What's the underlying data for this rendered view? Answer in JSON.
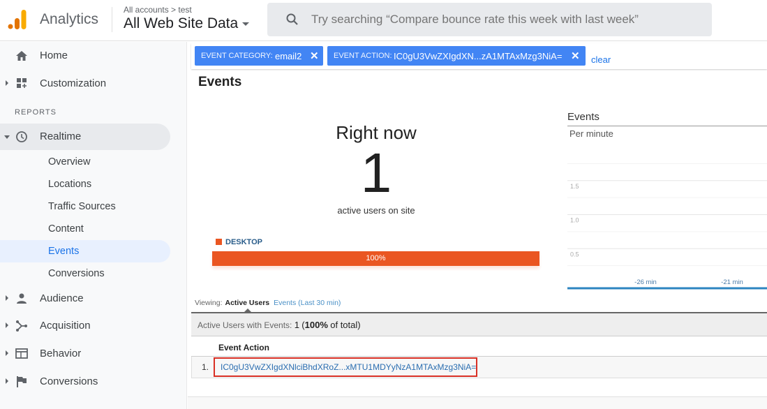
{
  "header": {
    "brand": "Analytics",
    "breadcrumb": "All accounts > test",
    "property": "All Web Site Data",
    "search_placeholder": "Try searching “Compare bounce rate this week with last week”",
    "logo_colors": [
      "#f9ab00",
      "#e37400"
    ]
  },
  "sidebar": {
    "top_items": [
      {
        "label": "Home",
        "icon": "home-icon"
      },
      {
        "label": "Customization",
        "icon": "dashboard-icon"
      }
    ],
    "section_label": "REPORTS",
    "realtime": {
      "label": "Realtime",
      "icon": "clock-icon",
      "children": [
        "Overview",
        "Locations",
        "Traffic Sources",
        "Content",
        "Events",
        "Conversions"
      ],
      "active_child": "Events"
    },
    "report_items": [
      {
        "label": "Audience",
        "icon": "person-icon"
      },
      {
        "label": "Acquisition",
        "icon": "acquisition-icon"
      },
      {
        "label": "Behavior",
        "icon": "behavior-icon"
      },
      {
        "label": "Conversions",
        "icon": "flag-icon"
      }
    ]
  },
  "filters": [
    {
      "key": "EVENT CATEGORY:",
      "value": "email2"
    },
    {
      "key": "EVENT ACTION:",
      "value": "IC0gU3VwZXIgdXN...zA1MTAxMzg3NiA="
    }
  ],
  "filters_clear": "clear",
  "page_title": "Events",
  "right_now": {
    "title": "Right now",
    "count": "1",
    "subtitle": "active users on site",
    "device_label": "DESKTOP",
    "device_percent": 100,
    "device_percent_label": "100%",
    "device_color": "#ea5622"
  },
  "chart_data": {
    "type": "bar",
    "title": "Events",
    "subtitle": "Per minute",
    "y_ticks": [
      "1.5",
      "1.0",
      "0.5"
    ],
    "x_ticks": [
      "-26 min",
      "-21 min"
    ],
    "ylim": [
      0,
      2
    ],
    "series": [
      {
        "name": "Events",
        "values": []
      }
    ],
    "grid": true,
    "axis_color": "#2c84c0"
  },
  "viewing": {
    "label": "Viewing:",
    "active_tab": "Active Users",
    "other_tab": "Events (Last 30 min)"
  },
  "table": {
    "summary_label": "Active Users with Events:",
    "summary_count": "1",
    "summary_pct": "100%",
    "summary_suffix": "of total)",
    "column_header": "Event Action",
    "rows": [
      {
        "index": "1.",
        "value": "IC0gU3VwZXIgdXNlciBhdXRoZ...xMTU1MDYyNzA1MTAxMzg3NiA="
      }
    ]
  }
}
